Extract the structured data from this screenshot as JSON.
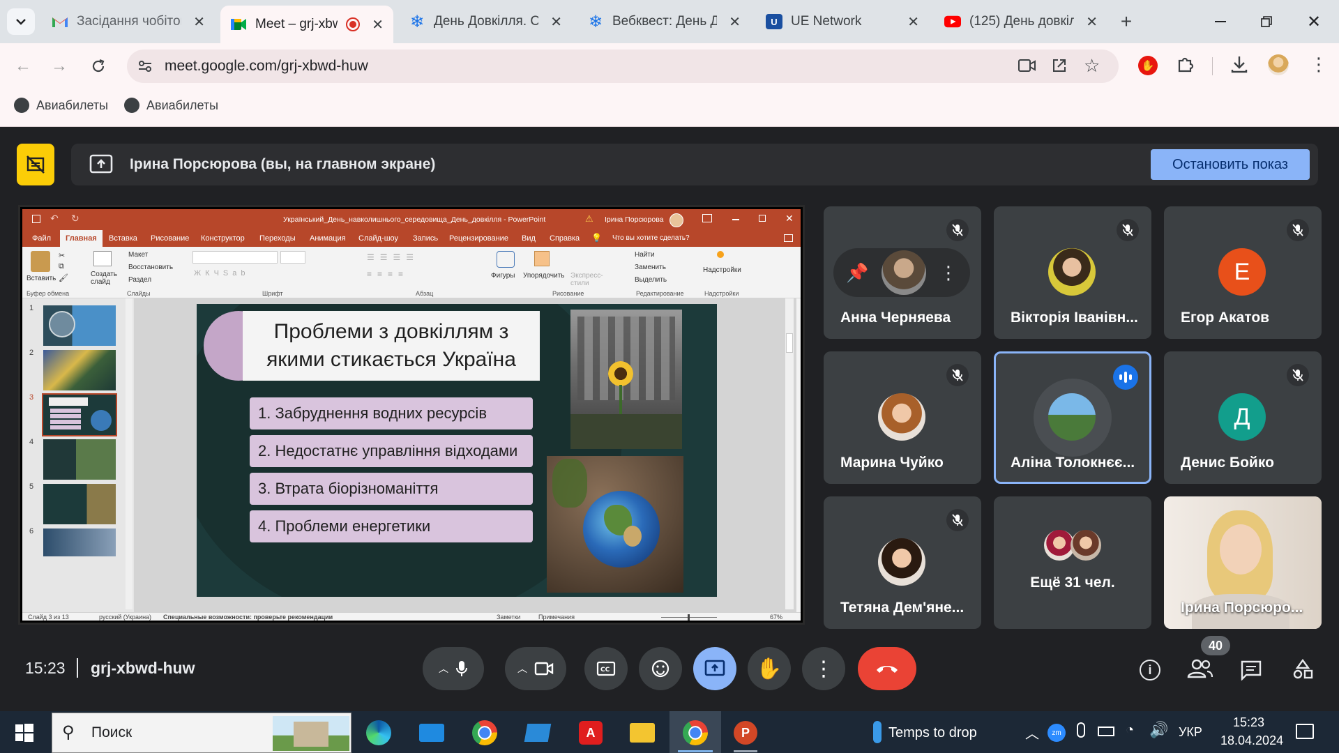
{
  "browser": {
    "tabs": [
      {
        "title": "Засідання чобіток",
        "icon": "gmail-icon",
        "active": false
      },
      {
        "title": "Meet – grj-xbw",
        "icon": "meet-icon",
        "active": true
      },
      {
        "title": "День Довкілля. Ст",
        "icon": "snowflake-icon",
        "active": false
      },
      {
        "title": "Вебквест: День Д",
        "icon": "snowflake-icon",
        "active": false
      },
      {
        "title": "UE Network",
        "icon": "ue-icon",
        "active": false
      },
      {
        "title": "(125) День довкіл",
        "icon": "youtube-icon",
        "active": false
      }
    ],
    "url": "meet.google.com/grj-xbwd-huw",
    "bookmarks": [
      "Авиабилеты",
      "Авиабилеты"
    ]
  },
  "meet": {
    "presenter_banner": "Ірина Порсюрова (вы, на главном экране)",
    "stop_button": "Остановить показ",
    "participants": [
      {
        "name": "Анна Черняева",
        "muted": true
      },
      {
        "name": "Вікторія Іванівн...",
        "muted": true
      },
      {
        "name": "Егор Акатов",
        "muted": true,
        "initial": "Е",
        "color": "#e8501a"
      },
      {
        "name": "Марина Чуйко",
        "muted": true
      },
      {
        "name": "Аліна Толокнєє...",
        "muted": false,
        "speaking": true
      },
      {
        "name": "Денис Бойко",
        "muted": true,
        "initial": "Д",
        "color": "#129e8c"
      },
      {
        "name": "Тетяна Дем'яне...",
        "muted": true
      },
      {
        "name": "Ещё 31 чел."
      },
      {
        "name": "Ірина Порсюро..."
      }
    ],
    "time": "15:23",
    "meeting_code": "grj-xbwd-huw",
    "participant_count": "40"
  },
  "ppt": {
    "title": "Український_День_навколишнього_середовища_День_довкілля - PowerPoint",
    "user": "Ірина Порсюрова",
    "tabs": [
      "Файл",
      "Главная",
      "Вставка",
      "Рисование",
      "Конструктор",
      "Переходы",
      "Анимация",
      "Слайд-шоу",
      "Запись",
      "Рецензирование",
      "Вид",
      "Справка",
      "Что вы хотите сделать?"
    ],
    "ribbon": {
      "paste": "Вставить",
      "create": "Создать слайд",
      "layout": "Макет",
      "reset": "Восстановить",
      "section": "Раздел",
      "shapes": "Фигуры",
      "arrange": "Упорядочить",
      "express": "Экспресс-стили",
      "find": "Найти",
      "replace": "Заменить",
      "select": "Выделить",
      "addins": "Надстройки",
      "groups": [
        "Буфер обмена",
        "Слайды",
        "Шрифт",
        "Абзац",
        "Рисование",
        "Редактирование",
        "Надстройки"
      ]
    },
    "slide_numbers": [
      "1",
      "2",
      "3",
      "4",
      "5",
      "6"
    ],
    "slide": {
      "title": "Проблеми з довкіллям з якими стикається Україна",
      "items": [
        "1. Забруднення водних ресурсів",
        "2. Недостатнє управління відходами",
        "3. Втрата біорізноманіття",
        "4. Проблеми енергетики"
      ]
    },
    "status": {
      "slide": "Слайд 3 из 13",
      "lang": "русский (Украина)",
      "access": "Специальные возможности: проверьте рекомендации",
      "notes": "Заметки",
      "comments": "Примечания",
      "zoom": "67%"
    }
  },
  "taskbar": {
    "search": "Поиск",
    "weather": "Temps to drop",
    "lang": "УКР",
    "time": "15:23",
    "date": "18.04.2024"
  }
}
